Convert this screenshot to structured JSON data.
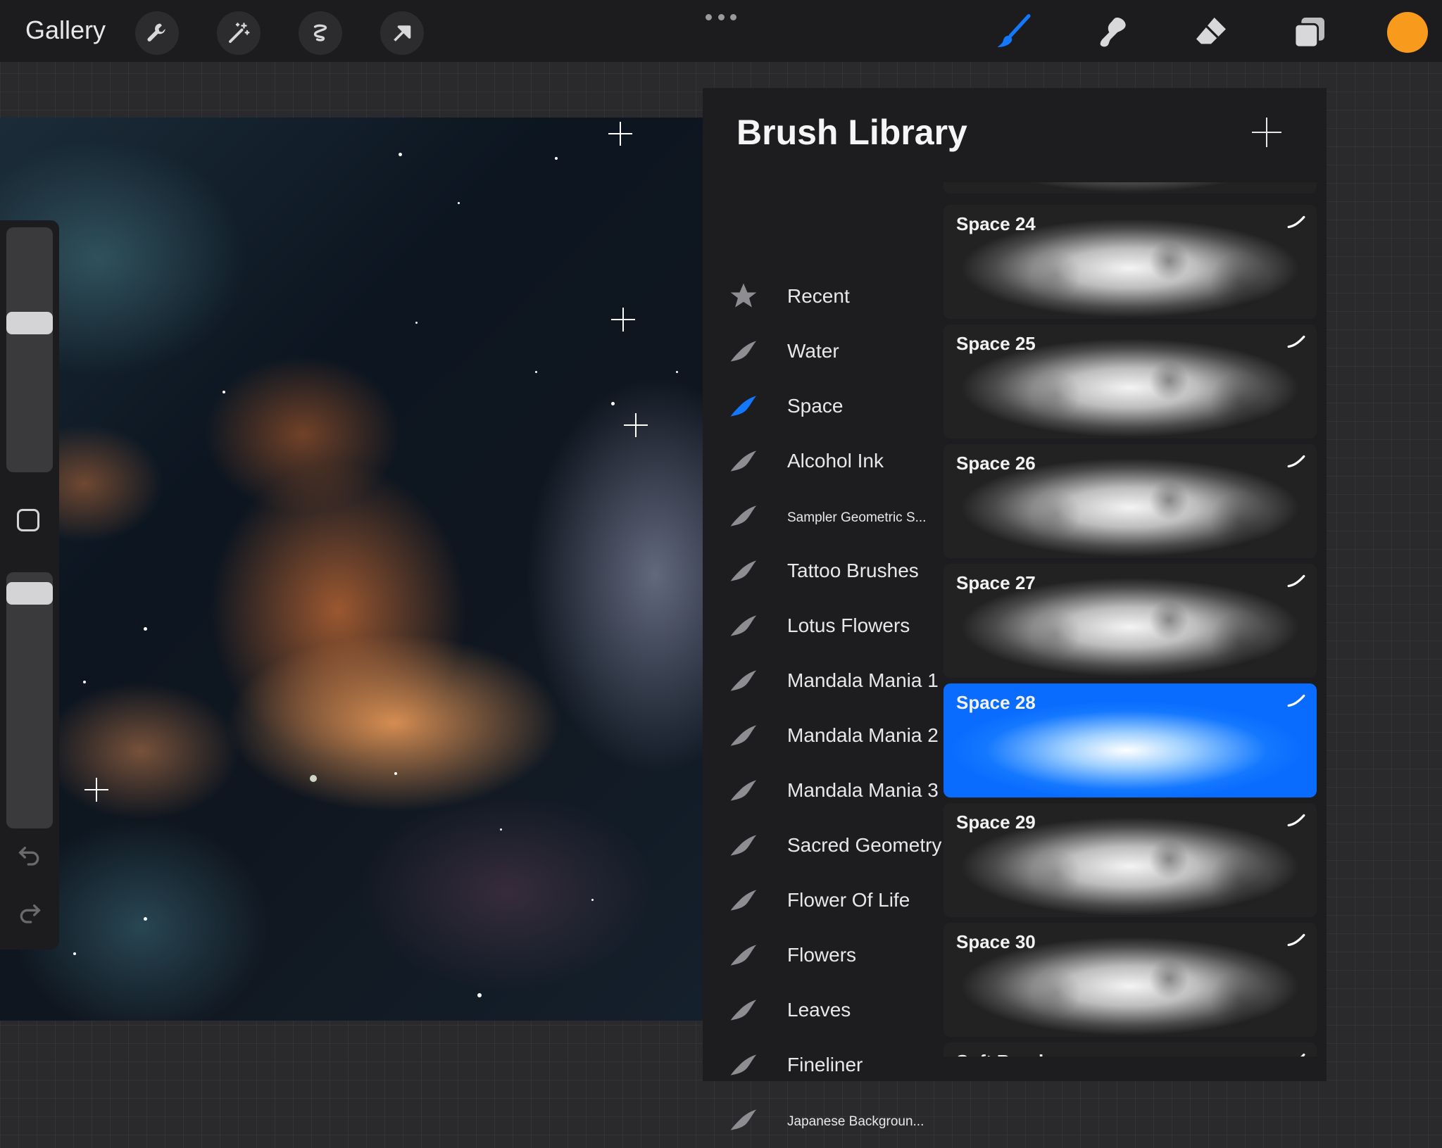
{
  "topbar": {
    "gallery_label": "Gallery",
    "tools": [
      {
        "icon": "wrench-icon"
      },
      {
        "icon": "magic-wand-icon"
      },
      {
        "icon": "selection-icon"
      },
      {
        "icon": "transform-arrow-icon"
      }
    ],
    "right_tools": [
      {
        "icon": "brush-icon",
        "active": true
      },
      {
        "icon": "smudge-icon"
      },
      {
        "icon": "eraser-icon"
      },
      {
        "icon": "layers-icon"
      }
    ],
    "current_color": "#f89a1c",
    "accent_color": "#1478ff"
  },
  "brush_library": {
    "title": "Brush Library",
    "sets": [
      {
        "label": "Recent",
        "icon": "star-icon"
      },
      {
        "label": "Water"
      },
      {
        "label": "Space",
        "selected": true
      },
      {
        "label": "Alcohol Ink"
      },
      {
        "label": "Sampler Geometric S...",
        "small": true
      },
      {
        "label": "Tattoo Brushes"
      },
      {
        "label": "Lotus Flowers"
      },
      {
        "label": "Mandala Mania 1"
      },
      {
        "label": "Mandala Mania 2"
      },
      {
        "label": "Mandala Mania 3"
      },
      {
        "label": "Sacred Geometry"
      },
      {
        "label": "Flower Of Life"
      },
      {
        "label": "Flowers"
      },
      {
        "label": "Leaves"
      },
      {
        "label": "Fineliner"
      },
      {
        "label": "Japanese Backgroun...",
        "small": true
      }
    ],
    "brushes": [
      {
        "name": "Space 24"
      },
      {
        "name": "Space 25"
      },
      {
        "name": "Space 26"
      },
      {
        "name": "Space 27"
      },
      {
        "name": "Space 28",
        "selected": true
      },
      {
        "name": "Space 29"
      },
      {
        "name": "Space 30"
      },
      {
        "name": "Soft Brush"
      }
    ]
  }
}
